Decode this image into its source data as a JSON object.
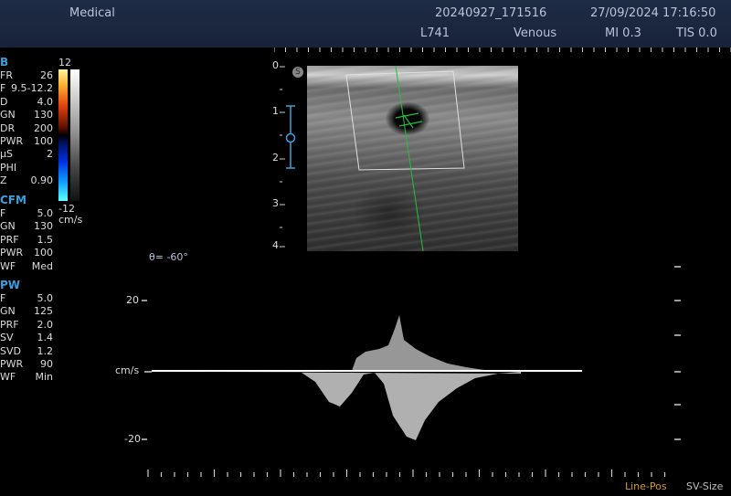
{
  "header": {
    "app_name": "Medical",
    "study_id": "20240927_171516",
    "datetime": "27/09/2024 17:16:50",
    "probe": "L741",
    "preset": "Venous",
    "mi": "MI 0.3",
    "tis": "TIS 0.0"
  },
  "b_mode": {
    "title": "B",
    "params": [
      {
        "k": "FR",
        "v": "26"
      },
      {
        "k": "F",
        "v": "9.5-12.2"
      },
      {
        "k": "D",
        "v": "4.0"
      },
      {
        "k": "GN",
        "v": "130"
      },
      {
        "k": "DR",
        "v": "200"
      },
      {
        "k": "PWR",
        "v": "100"
      },
      {
        "k": "µS",
        "v": "2"
      },
      {
        "k": "PHI",
        "v": ""
      },
      {
        "k": "Z",
        "v": "0.90"
      }
    ]
  },
  "color_scale": {
    "top": "12",
    "bottom": "-12",
    "unit": "cm/s"
  },
  "cfm": {
    "title": "CFM",
    "params": [
      {
        "k": "F",
        "v": "5.0"
      },
      {
        "k": "GN",
        "v": "130"
      },
      {
        "k": "PRF",
        "v": "1.5"
      },
      {
        "k": "PWR",
        "v": "100"
      },
      {
        "k": "WF",
        "v": "Med"
      }
    ]
  },
  "pw": {
    "title": "PW",
    "params": [
      {
        "k": "F",
        "v": "5.0"
      },
      {
        "k": "GN",
        "v": "125"
      },
      {
        "k": "PRF",
        "v": "2.0"
      },
      {
        "k": "SV",
        "v": "1.4"
      },
      {
        "k": "SVD",
        "v": "1.2"
      },
      {
        "k": "PWR",
        "v": "90"
      },
      {
        "k": "WF",
        "v": "Min"
      }
    ]
  },
  "depth_scale": [
    "0",
    "1",
    "2",
    "3",
    "4"
  ],
  "angle": "θ= -60°",
  "spectrum": {
    "label_top": "20",
    "label_bottom": "-20",
    "unit": "cm/s"
  },
  "softkeys": {
    "left": "Line-Pos",
    "right": "SV-Size"
  },
  "colors": {
    "accent_blue": "#3aa0e0",
    "softkey_left": "#d89a30",
    "softkey_right": "#bfbfbf",
    "doppler_line": "#22c040"
  }
}
